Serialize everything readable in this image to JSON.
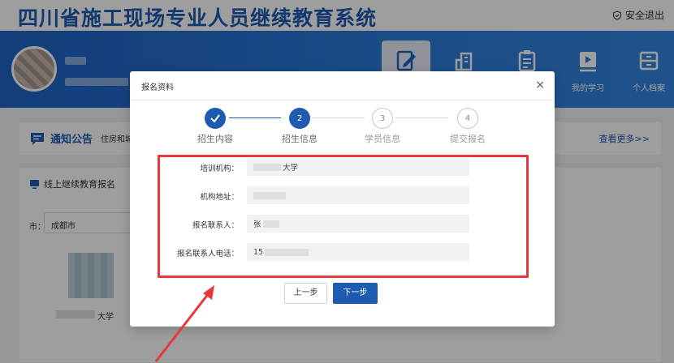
{
  "site": {
    "title": "四川省施工现场专业人员继续教育系统",
    "logout_label": "安全退出"
  },
  "nav": {
    "items": [
      {
        "label": "",
        "icon": "edit-icon",
        "active": true
      },
      {
        "label": "",
        "icon": "building-icon",
        "active": false
      },
      {
        "label": "",
        "icon": "clipboard-icon",
        "active": false
      },
      {
        "label": "我的学习",
        "icon": "video-icon",
        "active": false
      },
      {
        "label": "个人档案",
        "icon": "archive-icon",
        "active": false
      }
    ]
  },
  "notice": {
    "title": "通知公告",
    "text": "住房和城",
    "more": "查看更多>>"
  },
  "card": {
    "title": "线上继续教育报名",
    "city_label": "市：",
    "city_value": "成都市",
    "school_name": "大学"
  },
  "modal": {
    "title": "报名资料",
    "close": "×",
    "steps": [
      {
        "num": "",
        "label": "招生内容",
        "state": "done"
      },
      {
        "num": "2",
        "label": "招生信息",
        "state": "current"
      },
      {
        "num": "3",
        "label": "学员信息",
        "state": "todo"
      },
      {
        "num": "4",
        "label": "提交报名",
        "state": "todo"
      }
    ],
    "fields": [
      {
        "label": "培训机构：",
        "value": "大学"
      },
      {
        "label": "机构地址：",
        "value": ""
      },
      {
        "label": "报名联系人：",
        "value": "张"
      },
      {
        "label": "报名联系人电话：",
        "value": "15"
      }
    ],
    "prev_label": "上一步",
    "next_label": "下一步"
  },
  "colors": {
    "primary": "#1d5bb0",
    "highlight": "#e8373f"
  }
}
